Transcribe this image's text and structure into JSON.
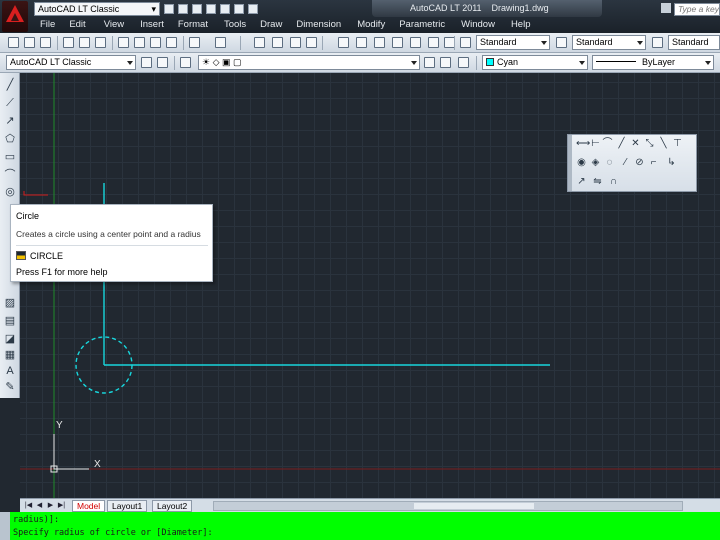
{
  "window": {
    "app_title": "AutoCAD LT 2011",
    "document_title": "Drawing1.dwg",
    "search_placeholder": "Type a keyword"
  },
  "quick_access": {
    "workspace": "AutoCAD LT Classic"
  },
  "menu": {
    "items": [
      "File",
      "Edit",
      "View",
      "Insert",
      "Format",
      "Tools",
      "Draw",
      "Dimension",
      "Modify",
      "Parametric",
      "Window",
      "Help"
    ]
  },
  "styles_toolbar": {
    "text_style": "Standard",
    "dim_style": "Standard",
    "table_style": "Standard"
  },
  "properties_toolbar": {
    "workspace": "AutoCAD LT Classic",
    "color": "Cyan",
    "linetype": "ByLayer",
    "accent_color": "#00ffff"
  },
  "tooltip": {
    "title": "Circle",
    "description": "Creates a circle using a center point and a radius",
    "command": "CIRCLE",
    "help": "Press F1 for more help"
  },
  "layout_tabs": {
    "tabs": [
      "Model",
      "Layout1",
      "Layout2"
    ],
    "active": "Model"
  },
  "ucs": {
    "y_label": "Y",
    "x_label": "X"
  },
  "command_line": {
    "line1": "radius)]:",
    "line2": "Specify radius of circle or [Diameter]:"
  },
  "colors": {
    "canvas": "#212830",
    "cyan": "#00ffff",
    "command_bg": "#00ff00"
  }
}
